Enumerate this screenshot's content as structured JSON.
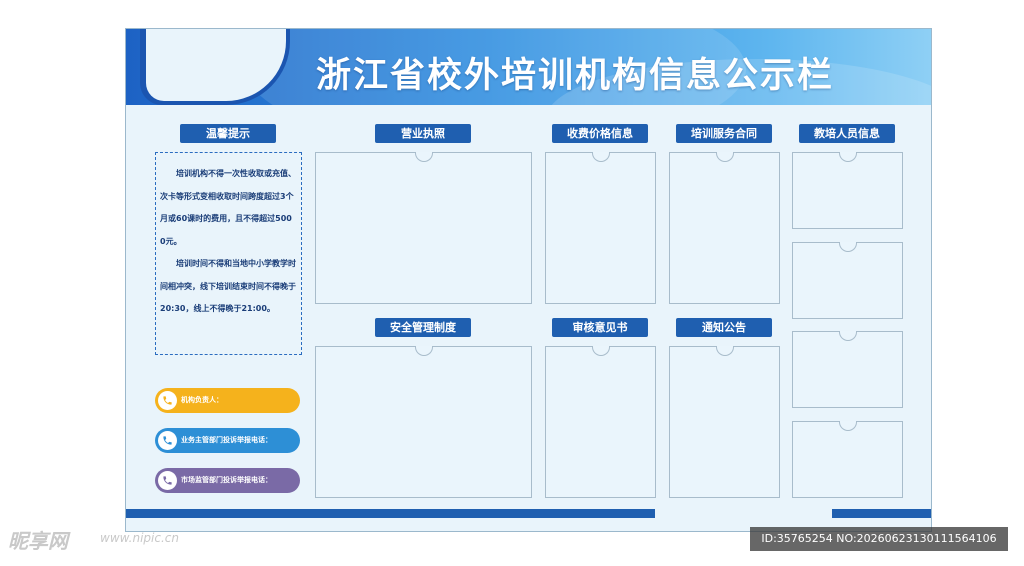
{
  "title": "浙江省校外培训机构信息公示栏",
  "notice": {
    "label": "温馨提示",
    "paragraph1": "培训机构不得一次性收取或充值、次卡等形式变相收取时间跨度超过3个月或60课时的费用，且不得超过5000元。",
    "paragraph2": "培训时间不得和当地中小学教学时间相冲突，线下培训结束时间不得晚于20:30，线上不得晚于21:00。"
  },
  "sections": {
    "business_license": "营业执照",
    "fee_info": "收费价格信息",
    "service_contract": "培训服务合同",
    "teacher_info": "教培人员信息",
    "safety_management": "安全管理制度",
    "review_opinion": "审核意见书",
    "notice_announcement": "通知公告"
  },
  "contacts": {
    "person_in_charge": "机构负责人：",
    "authority_phone": "业务主管部门投诉举报电话：",
    "market_phone": "市场监管部门投诉举报电话："
  },
  "colors": {
    "banner_dark": "#1d62c4",
    "banner_light": "#8fd0f5",
    "label_blue": "#1f5fb0",
    "pill_yellow": "#f5b21c",
    "pill_blue": "#2d8fd6",
    "pill_purple": "#7a6aa6"
  },
  "watermark": {
    "logo": "昵享网",
    "url": "www.nipic.cn",
    "id": "ID:35765254 NO:20260623130111564106"
  }
}
